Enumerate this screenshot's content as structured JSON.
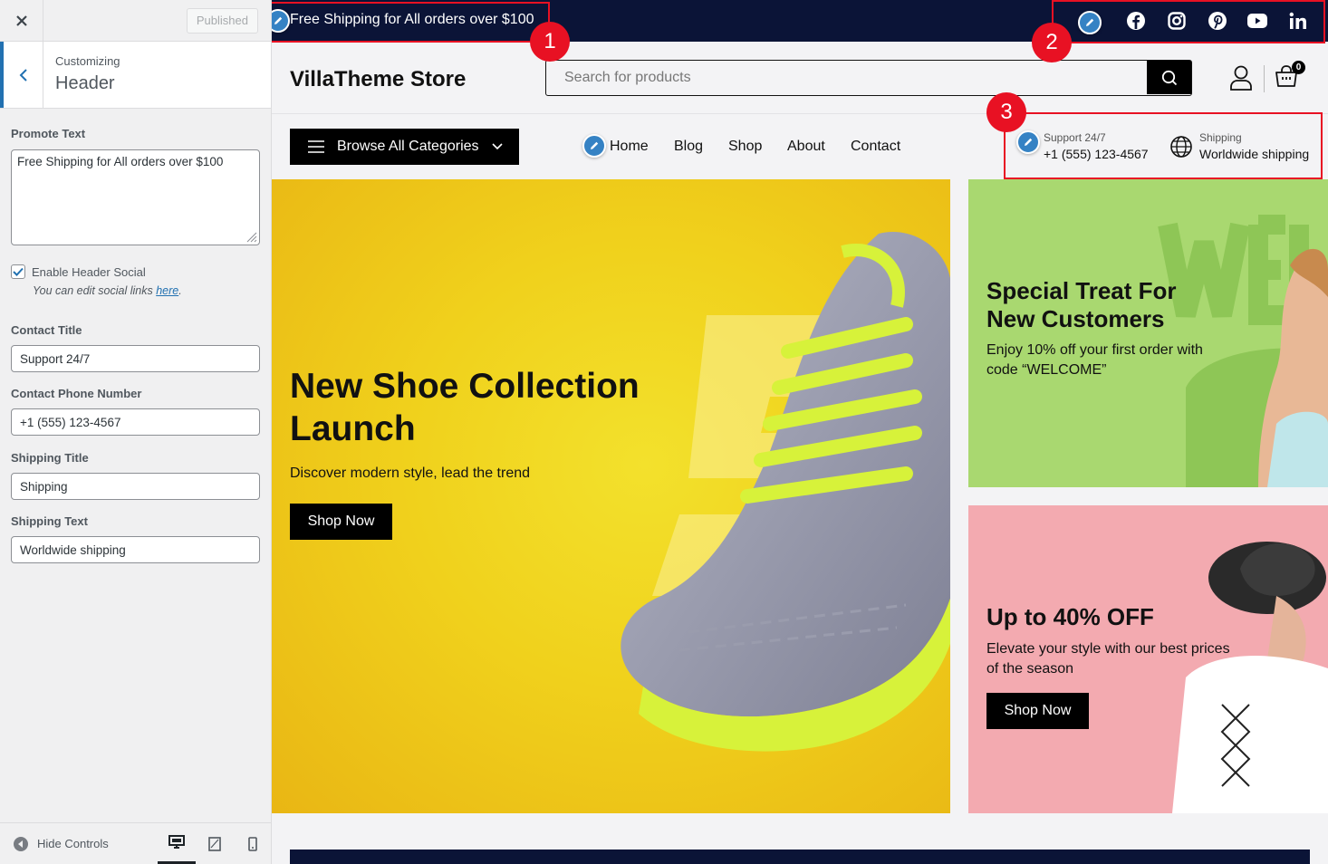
{
  "panel": {
    "publish_label": "Published",
    "breadcrumb": "Customizing",
    "section_title": "Header",
    "promote_label": "Promote Text",
    "promote_value": "Free Shipping for All orders over $100",
    "social_label": "Enable Header Social",
    "social_checked": true,
    "social_desc_prefix": "You can edit social links ",
    "social_desc_link": "here",
    "social_desc_suffix": ".",
    "contact_title_label": "Contact Title",
    "contact_title_value": "Support 24/7",
    "contact_phone_label": "Contact Phone Number",
    "contact_phone_value": "+1 (555) 123-4567",
    "shipping_title_label": "Shipping Title",
    "shipping_title_value": "Shipping",
    "shipping_text_label": "Shipping Text",
    "shipping_text_value": "Worldwide shipping",
    "hide_controls": "Hide Controls"
  },
  "preview": {
    "promo_text": "Free Shipping for All orders over $100",
    "store_name": "VillaTheme Store",
    "search_placeholder": "Search for products",
    "cart_count": "0",
    "browse_label": "Browse All Categories",
    "nav": [
      "Home",
      "Blog",
      "Shop",
      "About",
      "Contact"
    ],
    "support_title": "Support 24/7",
    "support_phone": "+1 (555) 123-4567",
    "shipping_title": "Shipping",
    "shipping_text": "Worldwide shipping",
    "hero": {
      "title": "New Shoe Collection Launch",
      "subtitle": "Discover modern style, lead the trend",
      "button": "Shop Now"
    },
    "promo1": {
      "title": "Special Treat For New Customers",
      "subtitle": "Enjoy 10% off your first order with code “WELCOME”"
    },
    "promo2": {
      "title": "Up to 40% OFF",
      "subtitle": "Elevate your style with our best prices of the season",
      "button": "Shop Now"
    }
  },
  "annotations": [
    "1",
    "2",
    "3"
  ],
  "colors": {
    "topbar": "#0b1437",
    "accent_red": "#e81123",
    "pencil_blue": "#3582c4",
    "wp_blue": "#2271b1",
    "hero_yellow": "#f0d11c",
    "promo_green": "#a9d870",
    "promo_pink": "#f3aab0"
  }
}
